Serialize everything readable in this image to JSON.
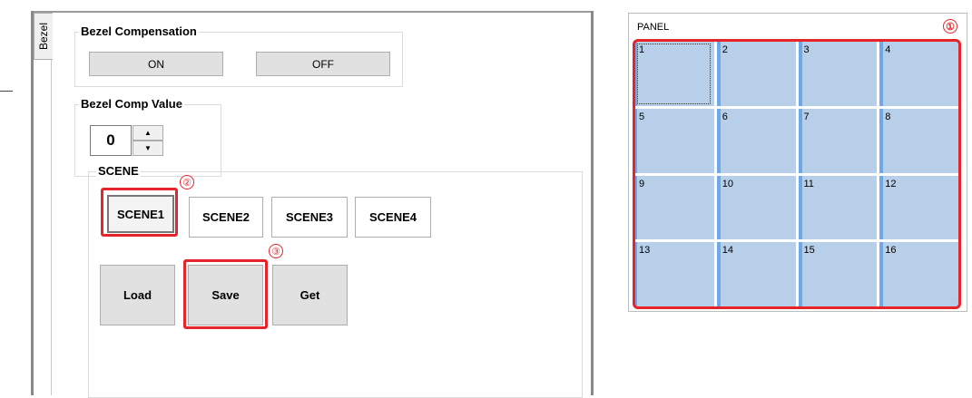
{
  "tabs": {
    "bezel": "Bezel"
  },
  "bezel_compensation": {
    "title": "Bezel Compensation",
    "on_label": "ON",
    "off_label": "OFF"
  },
  "bezel_comp_value": {
    "title": "Bezel Comp Value",
    "value": "0"
  },
  "scene": {
    "title": "SCENE",
    "buttons": [
      "SCENE1",
      "SCENE2",
      "SCENE3",
      "SCENE4"
    ],
    "load_label": "Load",
    "save_label": "Save",
    "get_label": "Get"
  },
  "panel": {
    "title": "PANEL",
    "cells": [
      "1",
      "2",
      "3",
      "4",
      "5",
      "6",
      "7",
      "8",
      "9",
      "10",
      "11",
      "12",
      "13",
      "14",
      "15",
      "16"
    ]
  },
  "annotations": {
    "one": "①",
    "two": "②",
    "three": "③"
  },
  "colors": {
    "highlight": "#e8242b",
    "cell_fill": "#b8cfe9",
    "cell_edge": "#6fa8e6"
  }
}
